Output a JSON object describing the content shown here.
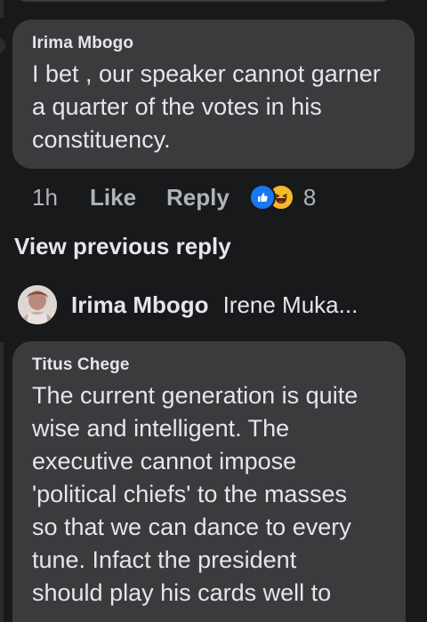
{
  "comment1": {
    "author": "Irima Mbogo",
    "text_lines": [
      "I bet , our speaker cannot garner",
      "a quarter of the votes in his",
      "constituency."
    ],
    "time": "1h",
    "like_label": "Like",
    "reply_label": "Reply",
    "reaction_count": "8",
    "reaction_icons": [
      "like-icon",
      "haha-icon"
    ]
  },
  "view_previous": "View previous reply",
  "reply_preview": {
    "author": "Irima Mbogo",
    "preview": "Irene Muka..."
  },
  "comment2": {
    "author": "Titus Chege",
    "text_lines": [
      "The current generation is quite",
      "wise and intelligent. The",
      "executive cannot impose",
      "'political chiefs' to the masses",
      "so that we can dance to every",
      "tune. Infact the president",
      "should play his cards well to"
    ]
  },
  "colors": {
    "background": "#18191a",
    "bubble": "#3a3b3c",
    "text": "#e4e6eb",
    "muted": "#b0b3b8",
    "like_blue": "#1877f2",
    "haha_yellow": "#f7b928"
  }
}
